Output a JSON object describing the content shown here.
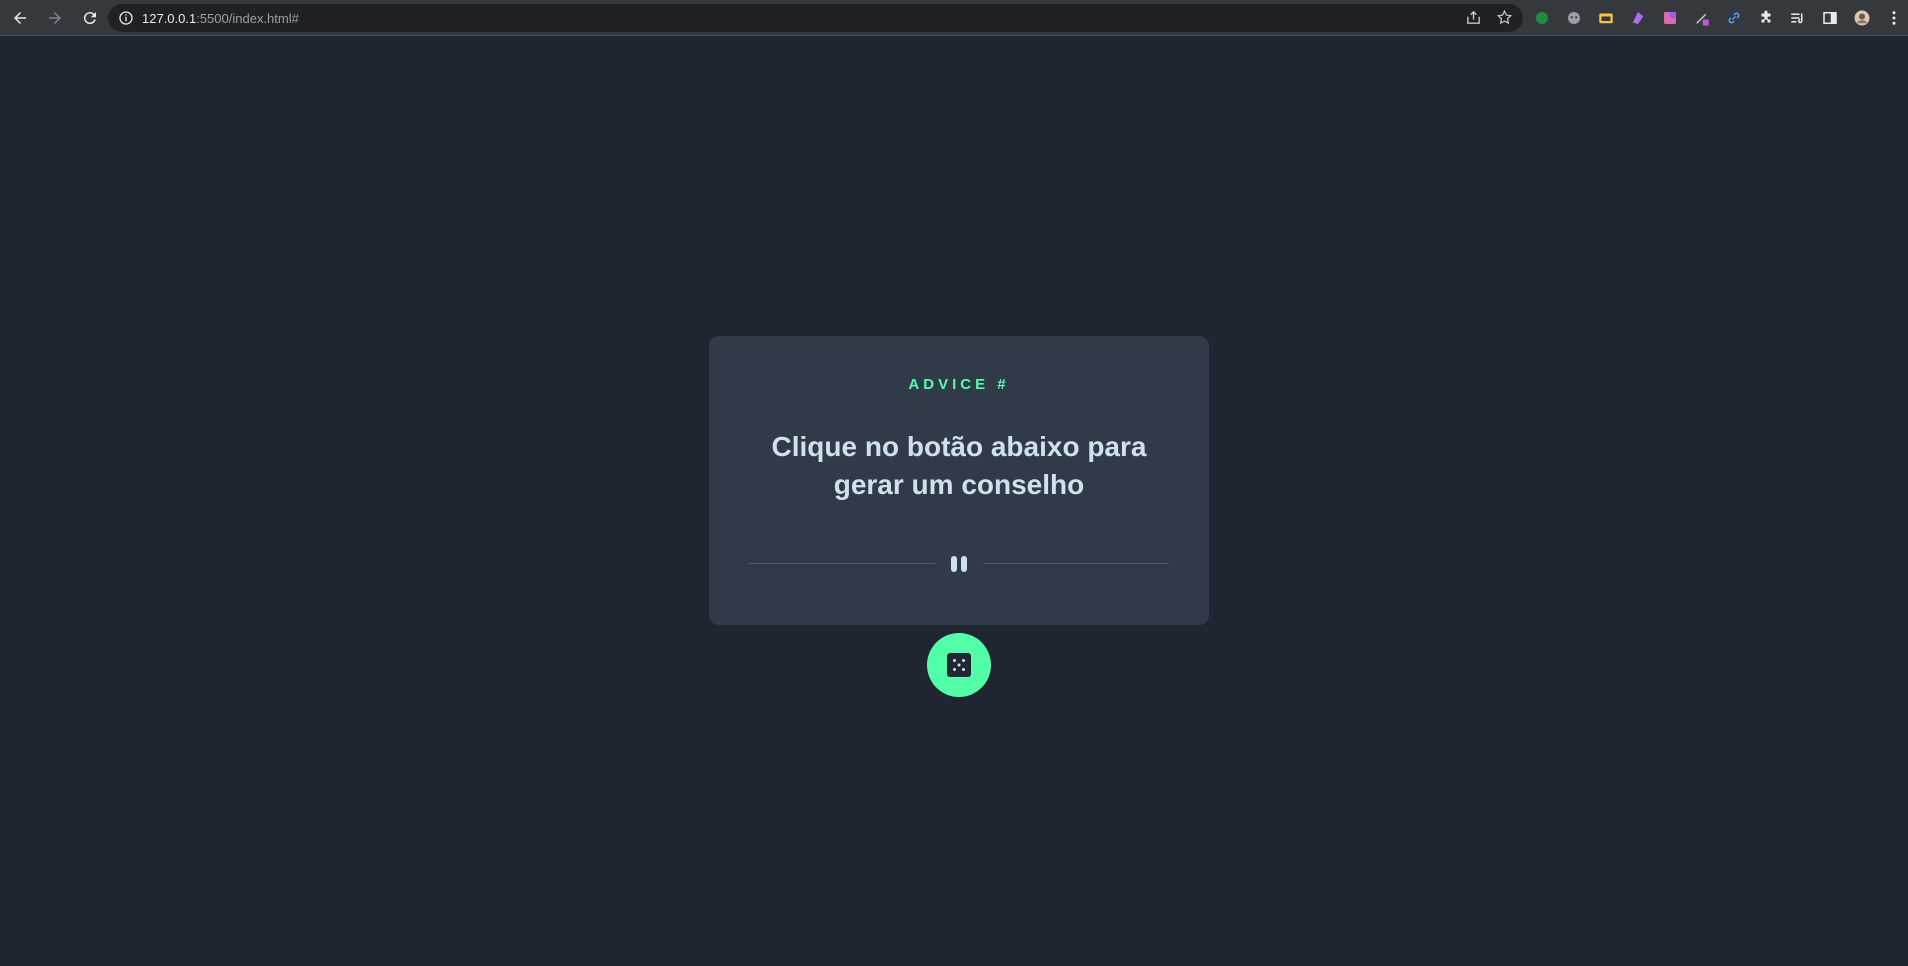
{
  "browser": {
    "url_host": "127.0.0.1",
    "url_rest": ":5500/index.html#",
    "icons": {
      "back": "arrow-left-icon",
      "forward": "arrow-right-icon",
      "reload": "reload-icon",
      "site_info": "info-icon",
      "share": "share-icon",
      "bookmark": "star-icon"
    },
    "extensions": [
      "green-leaf-extension-icon",
      "ghost-extension-icon",
      "folder-extension-icon",
      "purple-extension-icon",
      "pink-gradient-extension-icon",
      "color-picker-extension-icon",
      "link-extension-icon",
      "puzzle-extensions-icon",
      "reading-list-icon",
      "side-panel-icon",
      "profile-avatar",
      "kebab-menu-icon"
    ]
  },
  "card": {
    "label": "ADVICE #",
    "text": "Clique no botão abaixo para gerar um conselho",
    "divider_icon": "pause-icon",
    "button_icon": "dice-icon"
  },
  "colors": {
    "page_bg": "#1f2631",
    "card_bg": "#313a49",
    "accent": "#52ffa8",
    "advice_text": "#cee3e9"
  }
}
